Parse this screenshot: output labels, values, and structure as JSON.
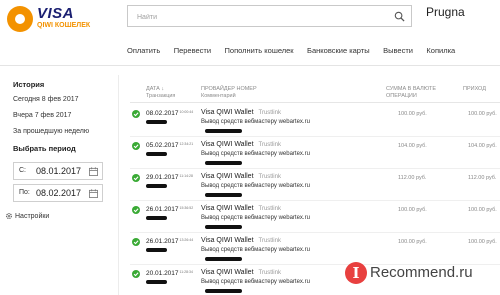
{
  "logo": {
    "brand": "VISA",
    "sub": "QIWI КОШЕЛЕК"
  },
  "search": {
    "placeholder": "Найти",
    "value": ""
  },
  "user": {
    "name": "Prugna"
  },
  "nav": [
    "Оплатить",
    "Перевести",
    "Пополнить кошелек",
    "Банковские карты",
    "Вывести",
    "Копилка"
  ],
  "sidebar": {
    "title": "История",
    "items": [
      "Сегодня 8 фев 2017",
      "Вчера 7 фев 2017",
      "За прошедшую неделю"
    ],
    "period_title": "Выбрать период",
    "from_label": "С:",
    "from_value": "08.01.2017",
    "to_label": "По:",
    "to_value": "08.02.2017",
    "settings": "Настройки"
  },
  "table": {
    "headers": {
      "date": "ДАТА ↓",
      "date_sub": "Транзакция",
      "provider": "ПРОВАЙДЕР НОМЕР",
      "provider_sub": "Комментарий",
      "amount": "СУММА В ВАЛЮТЕ ОПЕРАЦИИ",
      "income": "ПРИХОД"
    },
    "rows": [
      {
        "date": "08.02.2017",
        "time": "10:00:44",
        "provider": "Visa QIWI Wallet",
        "provider_sub": "Trustlink",
        "comment": "Вывод средств вебмастеру webartex.ru",
        "amount": "100.00 руб.",
        "income": "100.00 руб."
      },
      {
        "date": "05.02.2017",
        "time": "12:34:21",
        "provider": "Visa QIWI Wallet",
        "provider_sub": "Trustlink",
        "comment": "Вывод средств вебмастеру webartex.ru",
        "amount": "104.00 руб.",
        "income": "104.00 руб."
      },
      {
        "date": "29.01.2017",
        "time": "11:14:28",
        "provider": "Visa QIWI Wallet",
        "provider_sub": "Trustlink",
        "comment": "Вывод средств вебмастеру webartex.ru",
        "amount": "112.00 руб.",
        "income": "112.00 руб."
      },
      {
        "date": "26.01.2017",
        "time": "15:36:52",
        "provider": "Visa QIWI Wallet",
        "provider_sub": "Trustlink",
        "comment": "Вывод средств вебмастеру webartex.ru",
        "amount": "100.00 руб.",
        "income": "100.00 руб."
      },
      {
        "date": "26.01.2017",
        "time": "13:26:44",
        "provider": "Visa QIWI Wallet",
        "provider_sub": "Trustlink",
        "comment": "Вывод средств вебмастеру webartex.ru",
        "amount": "100.00 руб.",
        "income": "100.00 руб."
      },
      {
        "date": "20.01.2017",
        "time": "11:28:34",
        "provider": "Visa QIWI Wallet",
        "provider_sub": "Trustlink",
        "comment": "Вывод средств вебмастеру webartex.ru",
        "amount": "",
        "income": ""
      }
    ]
  },
  "watermark": {
    "letter": "I",
    "text": "Recommend.ru"
  },
  "colors": {
    "accent": "#f39200",
    "brand": "#1a1f71",
    "success": "#3aaa35",
    "watermark": "#e8403f"
  }
}
